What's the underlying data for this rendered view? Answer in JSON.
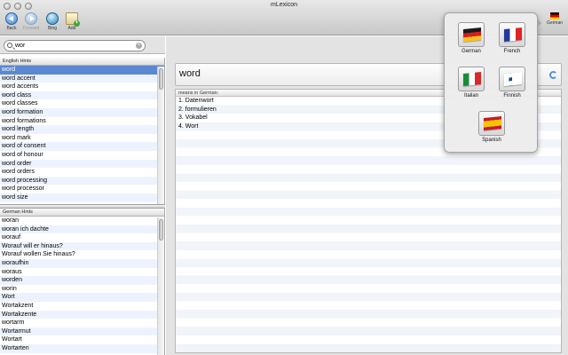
{
  "window": {
    "title": "mLexicon"
  },
  "toolbar": {
    "back_label": "Back",
    "forward_label": "Forward",
    "bing_label": "Bing",
    "add_label": "Add",
    "language_label": "German"
  },
  "search": {
    "value": "wor"
  },
  "english_hints": {
    "header": "English Hints",
    "items": [
      "word",
      "word accent",
      "word accents",
      "word class",
      "word classes",
      "word formation",
      "word formations",
      "word length",
      "word mark",
      "word of consent",
      "word of honour",
      "word order",
      "word orders",
      "word processing",
      "word processor",
      "word size"
    ]
  },
  "german_hints": {
    "header": "German Hints",
    "items": [
      "woran",
      "woran ich dachte",
      "worauf",
      "Worauf will er hinaus?",
      "Worauf wollen Sie hinaus?",
      "woraufhin",
      "woraus",
      "worden",
      "worin",
      "Wort",
      "Wortakzent",
      "Wortakzente",
      "wortarm",
      "Wortarmut",
      "Wortart",
      "Wortarten"
    ]
  },
  "main": {
    "word": "word",
    "translations_header": "means in German:",
    "translations": [
      "1. Datenwort",
      "2. formulieren",
      "3. Vokabel",
      "4. Wort"
    ]
  },
  "languages": {
    "german": "German",
    "french": "French",
    "italian": "Italian",
    "finnish": "Finnish",
    "spanish": "Spanish"
  },
  "colors": {
    "selection": "#5a88d3",
    "row_alt": "#edf3fe"
  }
}
